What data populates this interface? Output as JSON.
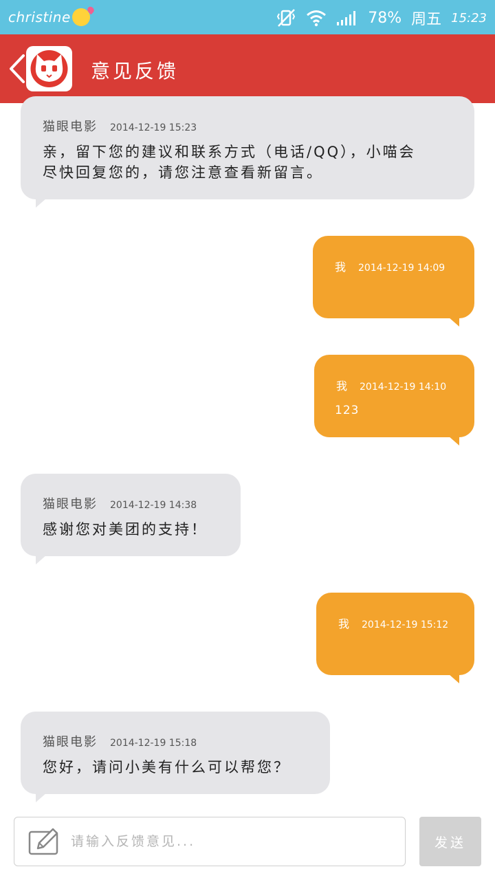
{
  "status_bar": {
    "username": "christine",
    "battery": "78%",
    "day": "周五",
    "time": "15:23"
  },
  "header": {
    "title": "意见反馈"
  },
  "messages": [
    {
      "direction": "in",
      "sender": "猫眼电影",
      "time": "2014-12-19 15:23",
      "text_line1": "亲，留下您的建议和联系方式（电话/QQ），小喵会",
      "text_line2": "尽快回复您的，请您注意查看新留言。"
    },
    {
      "direction": "out",
      "sender": "我",
      "time": "2014-12-19 14:09",
      "text": ""
    },
    {
      "direction": "out",
      "sender": "我",
      "time": "2014-12-19 14:10",
      "text": "123"
    },
    {
      "direction": "in",
      "sender": "猫眼电影",
      "time": "2014-12-19 14:38",
      "text": "感谢您对美团的支持！"
    },
    {
      "direction": "out",
      "sender": "我",
      "time": "2014-12-19 15:12",
      "text": ""
    },
    {
      "direction": "in",
      "sender": "猫眼电影",
      "time": "2014-12-19 15:18",
      "text": "您好，请问小美有什么可以帮您？"
    }
  ],
  "composer": {
    "placeholder": "请输入反馈意见...",
    "send_label": "发送"
  },
  "colors": {
    "status_bar": "#5fc3e0",
    "header": "#d83c36",
    "incoming_bubble": "#e5e5e8",
    "outgoing_bubble": "#f3a32c",
    "send_button": "#d2d2d2"
  }
}
